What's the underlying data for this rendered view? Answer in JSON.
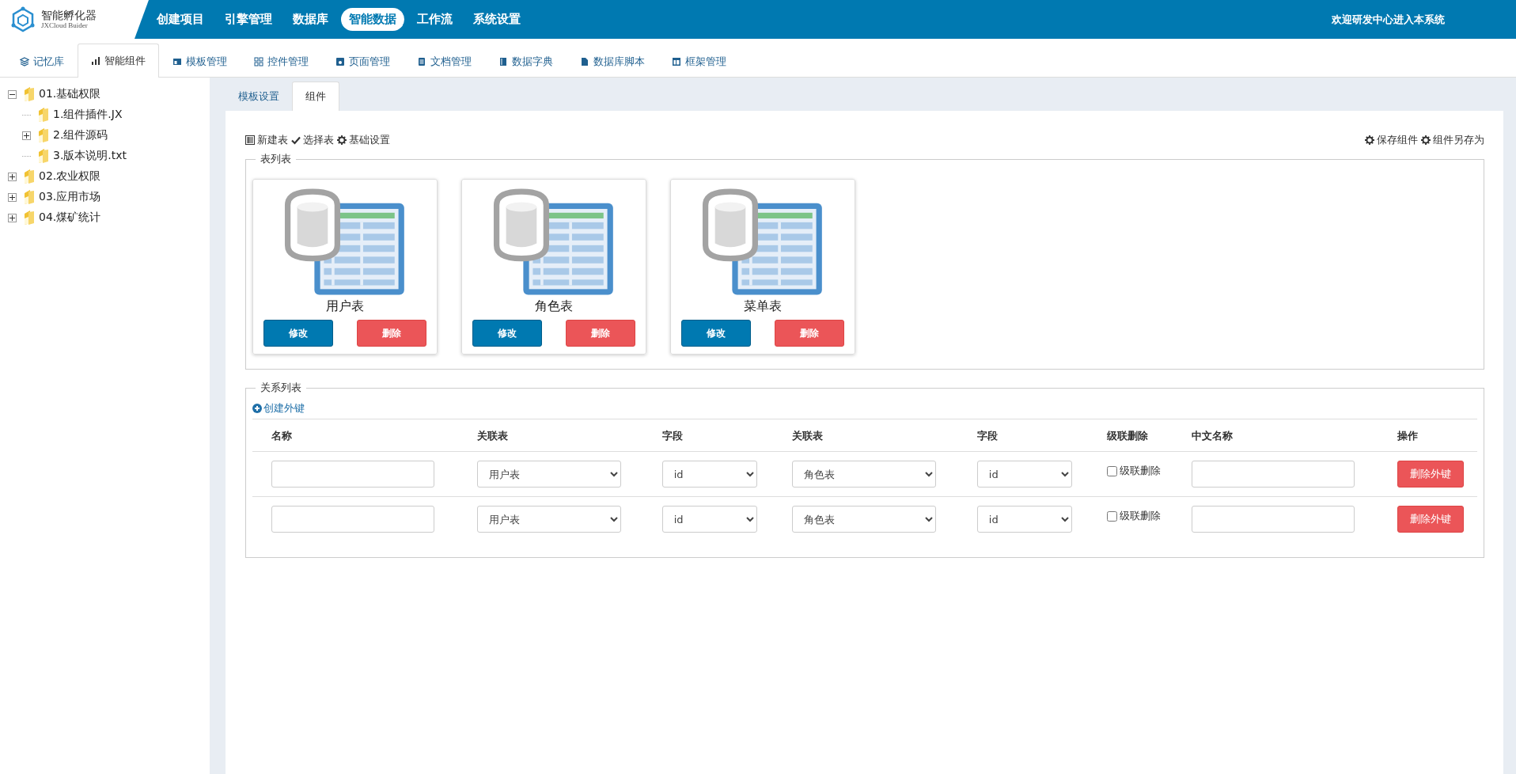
{
  "app": {
    "logo_title": "智能孵化器",
    "logo_subtitle": "JXCloud Buider",
    "welcome": "欢迎研发中心进入本系统"
  },
  "nav": [
    {
      "label": "创建项目",
      "selected": false
    },
    {
      "label": "引擎管理",
      "selected": false
    },
    {
      "label": "数据库",
      "selected": false
    },
    {
      "label": "智能数据",
      "selected": true
    },
    {
      "label": "工作流",
      "selected": false
    },
    {
      "label": "系统设置",
      "selected": false
    }
  ],
  "tabs": [
    {
      "label": "记忆库",
      "kind": "layers",
      "selected": false
    },
    {
      "label": "智能组件",
      "kind": "bars",
      "selected": true
    },
    {
      "label": "模板管理",
      "kind": "template",
      "selected": false
    },
    {
      "label": "控件管理",
      "kind": "grid",
      "selected": false
    },
    {
      "label": "页面管理",
      "kind": "window",
      "selected": false
    },
    {
      "label": "文档管理",
      "kind": "doc",
      "selected": false
    },
    {
      "label": "数据字典",
      "kind": "book",
      "selected": false
    },
    {
      "label": "数据库脚本",
      "kind": "file",
      "selected": false
    },
    {
      "label": "框架管理",
      "kind": "frame",
      "selected": false
    }
  ],
  "tree": [
    {
      "label": "01.基础权限",
      "kind": "branch",
      "expanded": true,
      "children": [
        {
          "label": "1.组件插件.JX",
          "kind": "leaf"
        },
        {
          "label": "2.组件源码",
          "kind": "branch",
          "expanded": false
        },
        {
          "label": "3.版本说明.txt",
          "kind": "leaf"
        }
      ]
    },
    {
      "label": "02.农业权限",
      "kind": "branch",
      "expanded": false
    },
    {
      "label": "03.应用市场",
      "kind": "branch",
      "expanded": false
    },
    {
      "label": "04.煤矿统计",
      "kind": "branch",
      "expanded": false
    }
  ],
  "sub_tabs": [
    {
      "label": "模板设置",
      "selected": false
    },
    {
      "label": "组件",
      "selected": true
    }
  ],
  "toolbar_left": [
    {
      "label": "新建表",
      "kind": "table"
    },
    {
      "label": "选择表",
      "kind": "check"
    },
    {
      "label": "基础设置",
      "kind": "gear"
    }
  ],
  "toolbar_right": [
    {
      "label": "保存组件",
      "kind": "gear"
    },
    {
      "label": "组件另存为",
      "kind": "gear"
    }
  ],
  "table_list": {
    "legend": "表列表",
    "cards": [
      {
        "name": "用户表",
        "edit": "修改",
        "delete": "删除"
      },
      {
        "name": "角色表",
        "edit": "修改",
        "delete": "删除"
      },
      {
        "name": "菜单表",
        "edit": "修改",
        "delete": "删除"
      }
    ]
  },
  "relations": {
    "legend": "关系列表",
    "create": "创建外键",
    "columns": [
      "名称",
      "关联表",
      "字段",
      "关联表",
      "字段",
      "级联删除",
      "中文名称",
      "操作"
    ],
    "rows": [
      {
        "name": "",
        "table": "用户表",
        "field": "id",
        "ref_table": "角色表",
        "ref_field": "id",
        "cascade_label": "级联删除",
        "cascade": false,
        "cn_name": "",
        "action": "删除外键"
      },
      {
        "name": "",
        "table": "用户表",
        "field": "id",
        "ref_table": "角色表",
        "ref_field": "id",
        "cascade_label": "级联删除",
        "cascade": false,
        "cn_name": "",
        "action": "删除外键"
      }
    ]
  }
}
